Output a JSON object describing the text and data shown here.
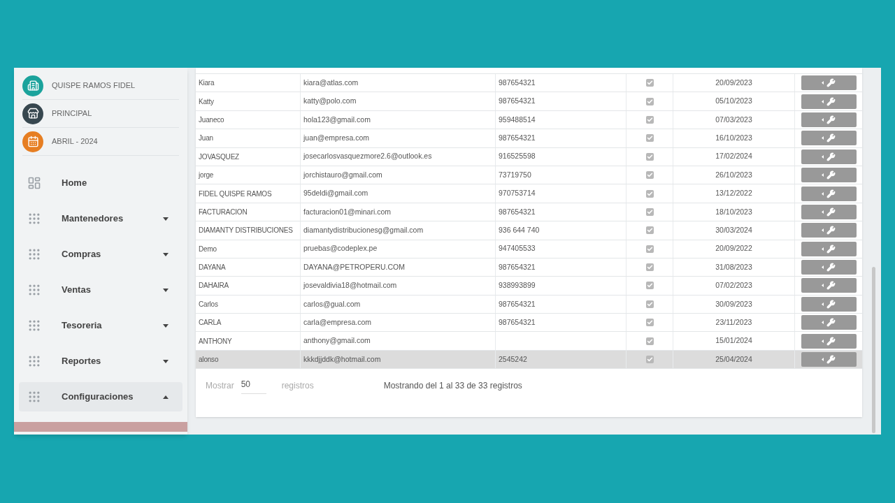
{
  "sidebar": {
    "header_items": [
      {
        "label": "QUISPE RAMOS FIDEL",
        "color": "#1ba39c"
      },
      {
        "label": "PRINCIPAL",
        "color": "#37474f"
      },
      {
        "label": "ABRIL - 2024",
        "color": "#e67e22"
      }
    ],
    "menu": [
      {
        "label": "Home",
        "kind": "home"
      },
      {
        "label": "Mantenedores",
        "kind": "group",
        "expanded": false
      },
      {
        "label": "Compras",
        "kind": "group",
        "expanded": false
      },
      {
        "label": "Ventas",
        "kind": "group",
        "expanded": false
      },
      {
        "label": "Tesoreria",
        "kind": "group",
        "expanded": false
      },
      {
        "label": "Reportes",
        "kind": "group",
        "expanded": false
      },
      {
        "label": "Configuraciones",
        "kind": "group",
        "expanded": true
      }
    ]
  },
  "table": {
    "rows": [
      {
        "name": "Kiara",
        "email": "kiara@atlas.com",
        "phone": "987654321",
        "checked": true,
        "date": "20/09/2023",
        "selected": false
      },
      {
        "name": "Katty",
        "email": "katty@polo.com",
        "phone": "987654321",
        "checked": true,
        "date": "05/10/2023",
        "selected": false
      },
      {
        "name": "Juaneco",
        "email": "hola123@gmail.com",
        "phone": "959488514",
        "checked": true,
        "date": "07/03/2023",
        "selected": false
      },
      {
        "name": "Juan",
        "email": "juan@empresa.com",
        "phone": "987654321",
        "checked": true,
        "date": "16/10/2023",
        "selected": false
      },
      {
        "name": "JOVASQUEZ",
        "email": "josecarlosvasquezmore2.6@outlook.es",
        "phone": "916525598",
        "checked": true,
        "date": "17/02/2024",
        "selected": false
      },
      {
        "name": "jorge",
        "email": "jorchistauro@gmail.com",
        "phone": "73719750",
        "checked": true,
        "date": "26/10/2023",
        "selected": false
      },
      {
        "name": "FIDEL QUISPE RAMOS",
        "email": "95deldi@gmail.com",
        "phone": "970753714",
        "checked": true,
        "date": "13/12/2022",
        "selected": false
      },
      {
        "name": "FACTURACION",
        "email": "facturacion01@minari.com",
        "phone": "987654321",
        "checked": true,
        "date": "18/10/2023",
        "selected": false
      },
      {
        "name": "DIAMANTY DISTRIBUCIONES",
        "email": "diamantydistribucionesg@gmail.com",
        "phone": "936 644 740",
        "checked": true,
        "date": "30/03/2024",
        "selected": false
      },
      {
        "name": "Demo",
        "email": "pruebas@codeplex.pe",
        "phone": "947405533",
        "checked": true,
        "date": "20/09/2022",
        "selected": false
      },
      {
        "name": "DAYANA",
        "email": "DAYANA@PETROPERU.COM",
        "phone": "987654321",
        "checked": true,
        "date": "31/08/2023",
        "selected": false
      },
      {
        "name": "DAHAIRA",
        "email": "josevaldivia18@hotmail.com",
        "phone": "938993899",
        "checked": true,
        "date": "07/02/2023",
        "selected": false
      },
      {
        "name": "Carlos",
        "email": "carlos@gual.com",
        "phone": "987654321",
        "checked": true,
        "date": "30/09/2023",
        "selected": false
      },
      {
        "name": "CARLA",
        "email": "carla@empresa.com",
        "phone": "987654321",
        "checked": true,
        "date": "23/11/2023",
        "selected": false
      },
      {
        "name": "ANTHONY",
        "email": "anthony@gmail.com",
        "checked": true,
        "date": "15/01/2024",
        "selected": false
      },
      {
        "name": "alonso",
        "email": "kkkdjjddk@hotmail.com",
        "phone": "2545242",
        "checked": true,
        "date": "25/04/2024",
        "selected": true
      }
    ]
  },
  "footer": {
    "show_label": "Mostrar",
    "page_size": "50",
    "suffix": "registros",
    "info": "Mostrando del 1 al 33 de 33 registros"
  }
}
